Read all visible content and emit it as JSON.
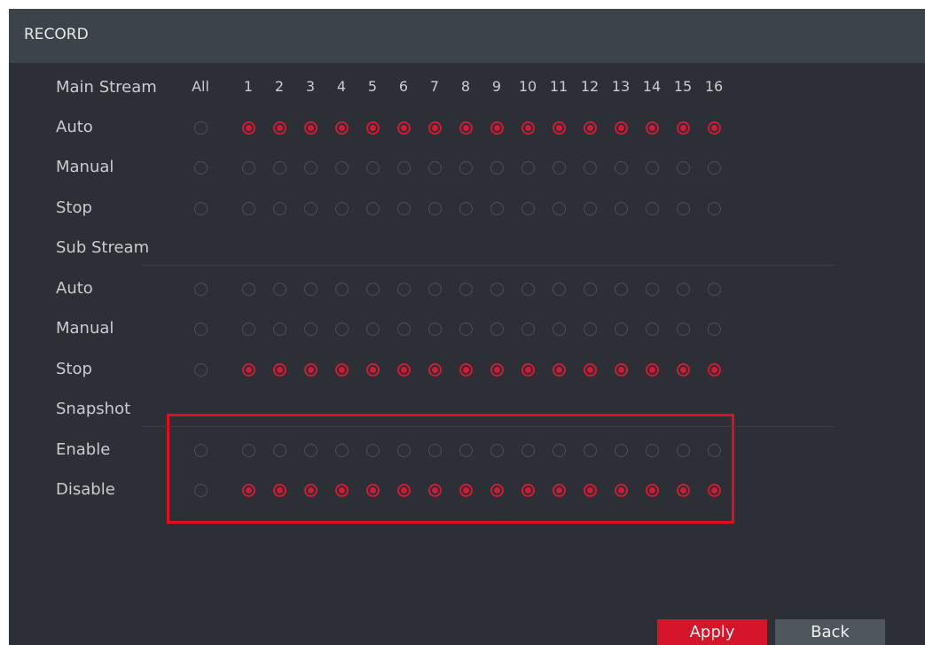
{
  "window": {
    "title": "RECORD"
  },
  "columns": {
    "all_label": "All",
    "channels": [
      "1",
      "2",
      "3",
      "4",
      "5",
      "6",
      "7",
      "8",
      "9",
      "10",
      "11",
      "12",
      "13",
      "14",
      "15",
      "16"
    ]
  },
  "sections": [
    {
      "name": "Main Stream",
      "rows": [
        {
          "label": "Auto",
          "all": false,
          "channels": [
            true,
            true,
            true,
            true,
            true,
            true,
            true,
            true,
            true,
            true,
            true,
            true,
            true,
            true,
            true,
            true
          ]
        },
        {
          "label": "Manual",
          "all": false,
          "channels": [
            false,
            false,
            false,
            false,
            false,
            false,
            false,
            false,
            false,
            false,
            false,
            false,
            false,
            false,
            false,
            false
          ]
        },
        {
          "label": "Stop",
          "all": false,
          "channels": [
            false,
            false,
            false,
            false,
            false,
            false,
            false,
            false,
            false,
            false,
            false,
            false,
            false,
            false,
            false,
            false
          ]
        }
      ]
    },
    {
      "name": "Sub Stream",
      "rows": [
        {
          "label": "Auto",
          "all": false,
          "channels": [
            false,
            false,
            false,
            false,
            false,
            false,
            false,
            false,
            false,
            false,
            false,
            false,
            false,
            false,
            false,
            false
          ]
        },
        {
          "label": "Manual",
          "all": false,
          "channels": [
            false,
            false,
            false,
            false,
            false,
            false,
            false,
            false,
            false,
            false,
            false,
            false,
            false,
            false,
            false,
            false
          ]
        },
        {
          "label": "Stop",
          "all": false,
          "channels": [
            true,
            true,
            true,
            true,
            true,
            true,
            true,
            true,
            true,
            true,
            true,
            true,
            true,
            true,
            true,
            true
          ]
        }
      ]
    },
    {
      "name": "Snapshot",
      "rows": [
        {
          "label": "Enable",
          "all": false,
          "channels": [
            false,
            false,
            false,
            false,
            false,
            false,
            false,
            false,
            false,
            false,
            false,
            false,
            false,
            false,
            false,
            false
          ]
        },
        {
          "label": "Disable",
          "all": false,
          "channels": [
            true,
            true,
            true,
            true,
            true,
            true,
            true,
            true,
            true,
            true,
            true,
            true,
            true,
            true,
            true,
            true
          ]
        }
      ]
    }
  ],
  "buttons": {
    "apply": "Apply",
    "back": "Back"
  },
  "colors": {
    "accent": "#cf1b34",
    "highlight": "#e10e1f",
    "panel": "#2c2f35",
    "titlebar": "#3d434a"
  }
}
